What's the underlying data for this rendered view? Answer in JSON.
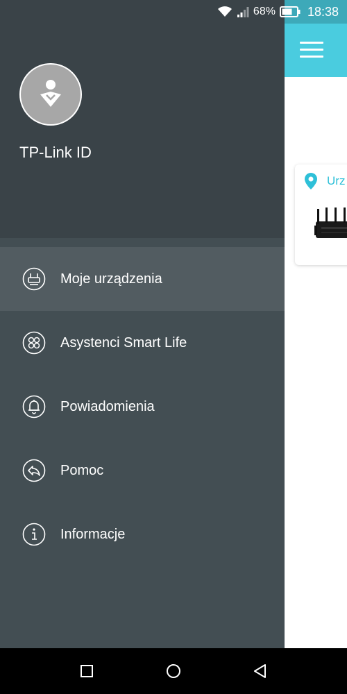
{
  "status_bar": {
    "battery_percent": "68%",
    "time": "18:38"
  },
  "account": {
    "name": "TP-Link ID"
  },
  "menu": {
    "items": [
      {
        "label": "Moje urządzenia",
        "icon": "router-icon",
        "active": true
      },
      {
        "label": "Asystenci Smart Life",
        "icon": "smart-life-icon",
        "active": false
      },
      {
        "label": "Powiadomienia",
        "icon": "bell-icon",
        "active": false
      },
      {
        "label": "Pomoc",
        "icon": "help-icon",
        "active": false
      },
      {
        "label": "Informacje",
        "icon": "info-icon",
        "active": false
      }
    ]
  },
  "background_app": {
    "card_location": "Urz"
  },
  "colors": {
    "drawer_header": "#3a4348",
    "drawer_body": "#434e53",
    "active_item": "#525c61",
    "accent": "#4accdf"
  }
}
